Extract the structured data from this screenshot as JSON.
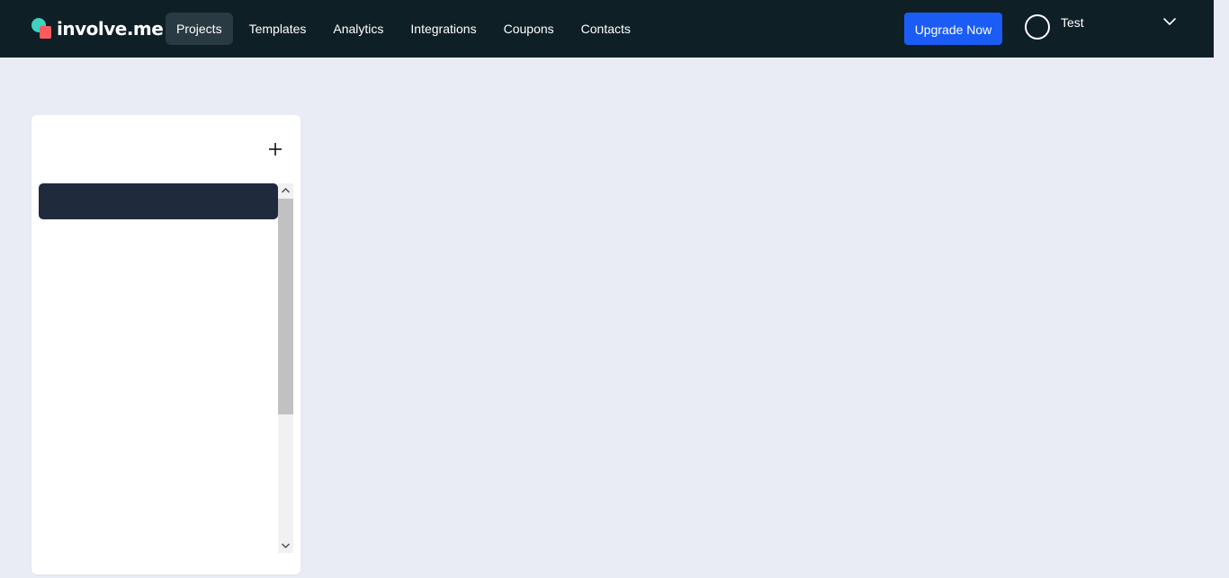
{
  "header": {
    "logo_text": "involve.me",
    "nav": [
      {
        "label": "Projects",
        "active": true
      },
      {
        "label": "Templates",
        "active": false
      },
      {
        "label": "Analytics",
        "active": false
      },
      {
        "label": "Integrations",
        "active": false
      },
      {
        "label": "Coupons",
        "active": false
      },
      {
        "label": "Contacts",
        "active": false
      }
    ],
    "upgrade_label": "Upgrade Now",
    "user": {
      "name": "Test",
      "avatar_icon": "avatar-circle-icon",
      "dropdown_icon": "chevron-down-icon"
    }
  },
  "sidebar_panel": {
    "add_icon": "plus-icon",
    "items": [
      {
        "label": ""
      }
    ]
  },
  "colors": {
    "topbar": "#0f1f26",
    "background": "#eaecf5",
    "accent": "#1a5cf5",
    "active_nav": "#2a3a42",
    "selected_item": "#1f2a3c",
    "logo_teal": "#3fd2c0",
    "logo_coral": "#ff5a5f"
  }
}
